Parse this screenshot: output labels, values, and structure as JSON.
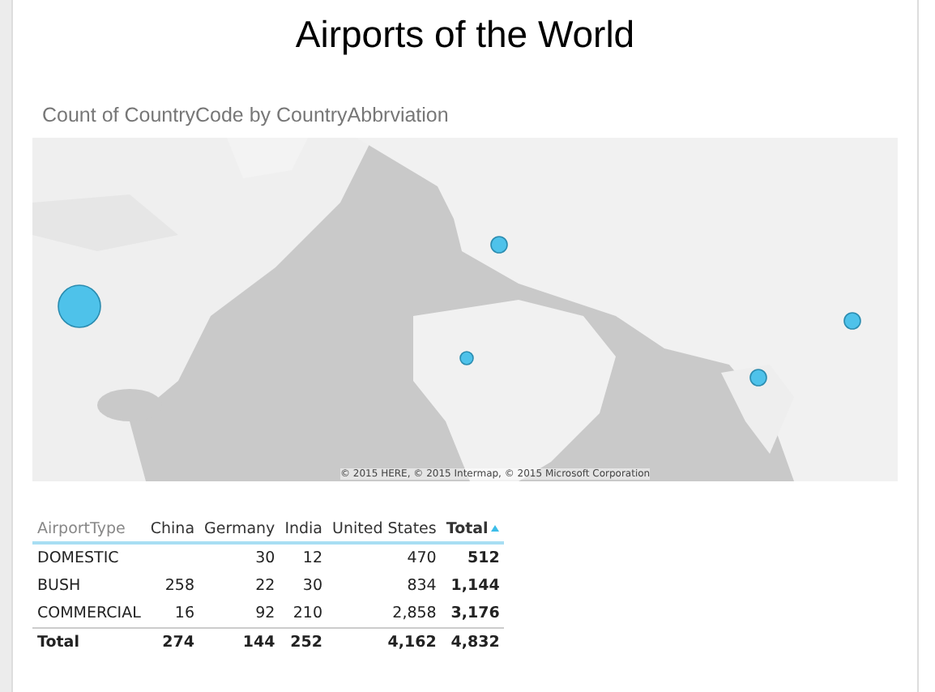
{
  "title": "Airports of the World",
  "visual": {
    "title": "Count of CountryCode by CountryAbbrviation",
    "map": {
      "kind": "picture",
      "attribution": "© 2015 HERE, © 2015 Intermap, © 2015 Microsoft Corporation"
    }
  },
  "table": {
    "columns": [
      {
        "label": "AirportType",
        "sorted": false
      },
      {
        "label": "China",
        "sorted": false
      },
      {
        "label": "Germany",
        "sorted": false
      },
      {
        "label": "India",
        "sorted": false
      },
      {
        "label": "United States",
        "sorted": false
      },
      {
        "label": "Total",
        "sorted": true
      }
    ],
    "rows": [
      [
        "DOMESTIC",
        "",
        "30",
        "12",
        "470",
        "512"
      ],
      [
        "BUSH",
        "258",
        "22",
        "30",
        "834",
        "1,144"
      ],
      [
        "COMMERCIAL",
        "16",
        "92",
        "210",
        "2,858",
        "3,176"
      ]
    ],
    "total": [
      "Total",
      "274",
      "144",
      "252",
      "4,162",
      "4,832"
    ]
  }
}
